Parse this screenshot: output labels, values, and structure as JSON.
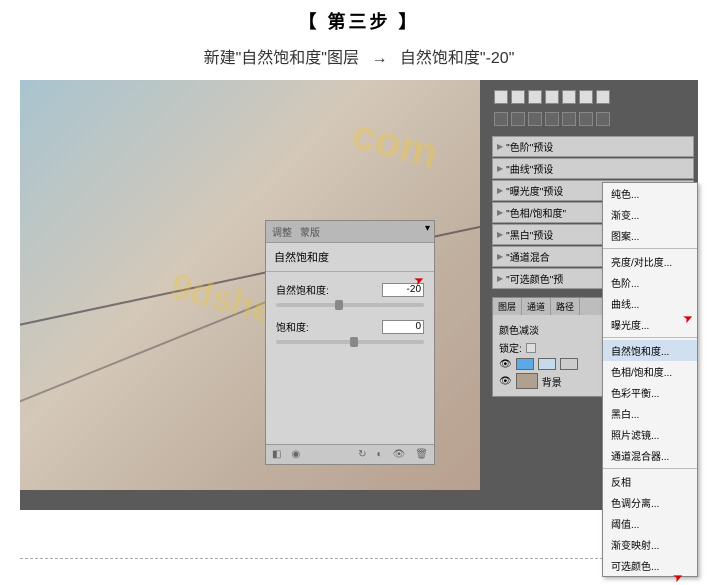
{
  "header": {
    "title": "【 第三步 】",
    "subtitle_pre": "新建\"自然饱和度\"图层",
    "subtitle_arrow": "→",
    "subtitle_post": "自然饱和度\"-20\""
  },
  "vibrance_panel": {
    "tab1": "调整",
    "tab2": "蒙版",
    "title": "自然饱和度",
    "field1_label": "自然饱和度:",
    "field1_value": "-20",
    "field2_label": "饱和度:",
    "field2_value": "0"
  },
  "presets": [
    "\"色阶\"预设",
    "\"曲线\"预设",
    "\"曝光度\"预设",
    "\"色相/饱和度\"",
    "\"黑白\"预设",
    "\"通道混合",
    "\"可选颜色\"预"
  ],
  "swatches": {
    "tab1": "图层",
    "tab2": "通道",
    "tab3": "路径",
    "mode": "颜色减淡",
    "lock": "锁定:",
    "bg_label": "背景"
  },
  "menu": {
    "items": [
      "纯色...",
      "渐变...",
      "图案...",
      "亮度/对比度...",
      "色阶...",
      "曲线...",
      "曝光度...",
      "自然饱和度...",
      "色相/饱和度...",
      "色彩平衡...",
      "黑白...",
      "照片滤镜...",
      "通道混合器...",
      "反相",
      "色调分离...",
      "阈值...",
      "渐变映射...",
      "可选颜色..."
    ]
  },
  "watermark": "com",
  "watermark2": "9dsheji"
}
